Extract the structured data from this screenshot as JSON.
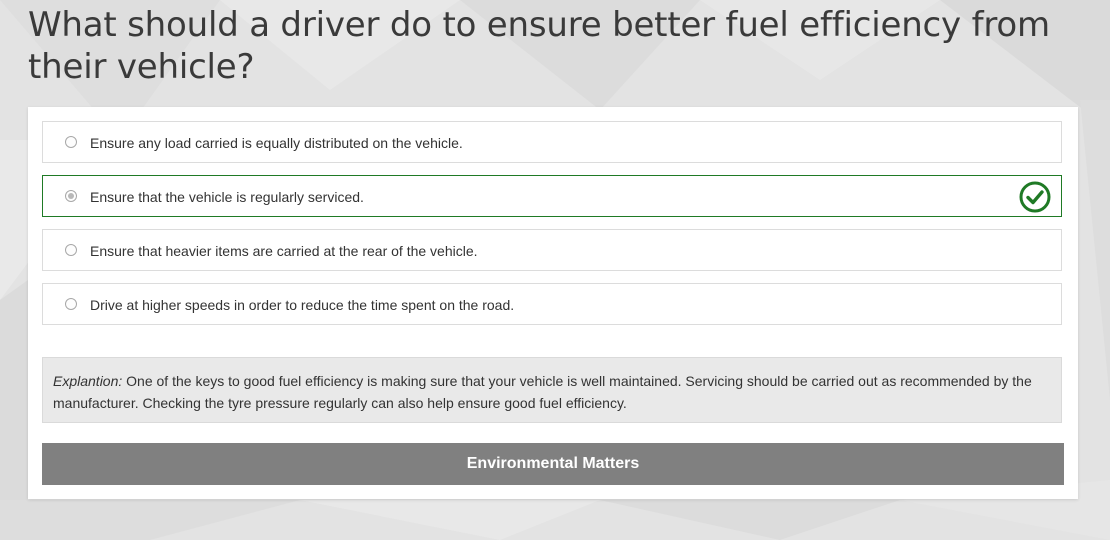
{
  "question": {
    "text": "What should a driver do to ensure better fuel efficiency from their vehicle?"
  },
  "options": [
    {
      "label": "Ensure any load carried is equally distributed on the vehicle.",
      "selected": false,
      "correct": false
    },
    {
      "label": "Ensure that the vehicle is regularly serviced.",
      "selected": true,
      "correct": true
    },
    {
      "label": "Ensure that heavier items are carried at the rear of the vehicle.",
      "selected": false,
      "correct": false
    },
    {
      "label": "Drive at higher speeds in order to reduce the time spent on the road.",
      "selected": false,
      "correct": false
    }
  ],
  "explanation": {
    "label": "Explantion:",
    "text": " One of the keys to good fuel efficiency is making sure that your vehicle is well maintained. Servicing should be carried out as recommended by the manufacturer. Checking the tyre pressure regularly can also help ensure good fuel efficiency."
  },
  "category": {
    "label": "Environmental Matters"
  },
  "colors": {
    "correct_accent": "#1f7a25",
    "button_background": "#808080",
    "explanation_background": "#e9e9e9",
    "page_background": "#e4e4e4"
  },
  "icons": {
    "correct_marker": "check-circle-icon"
  }
}
